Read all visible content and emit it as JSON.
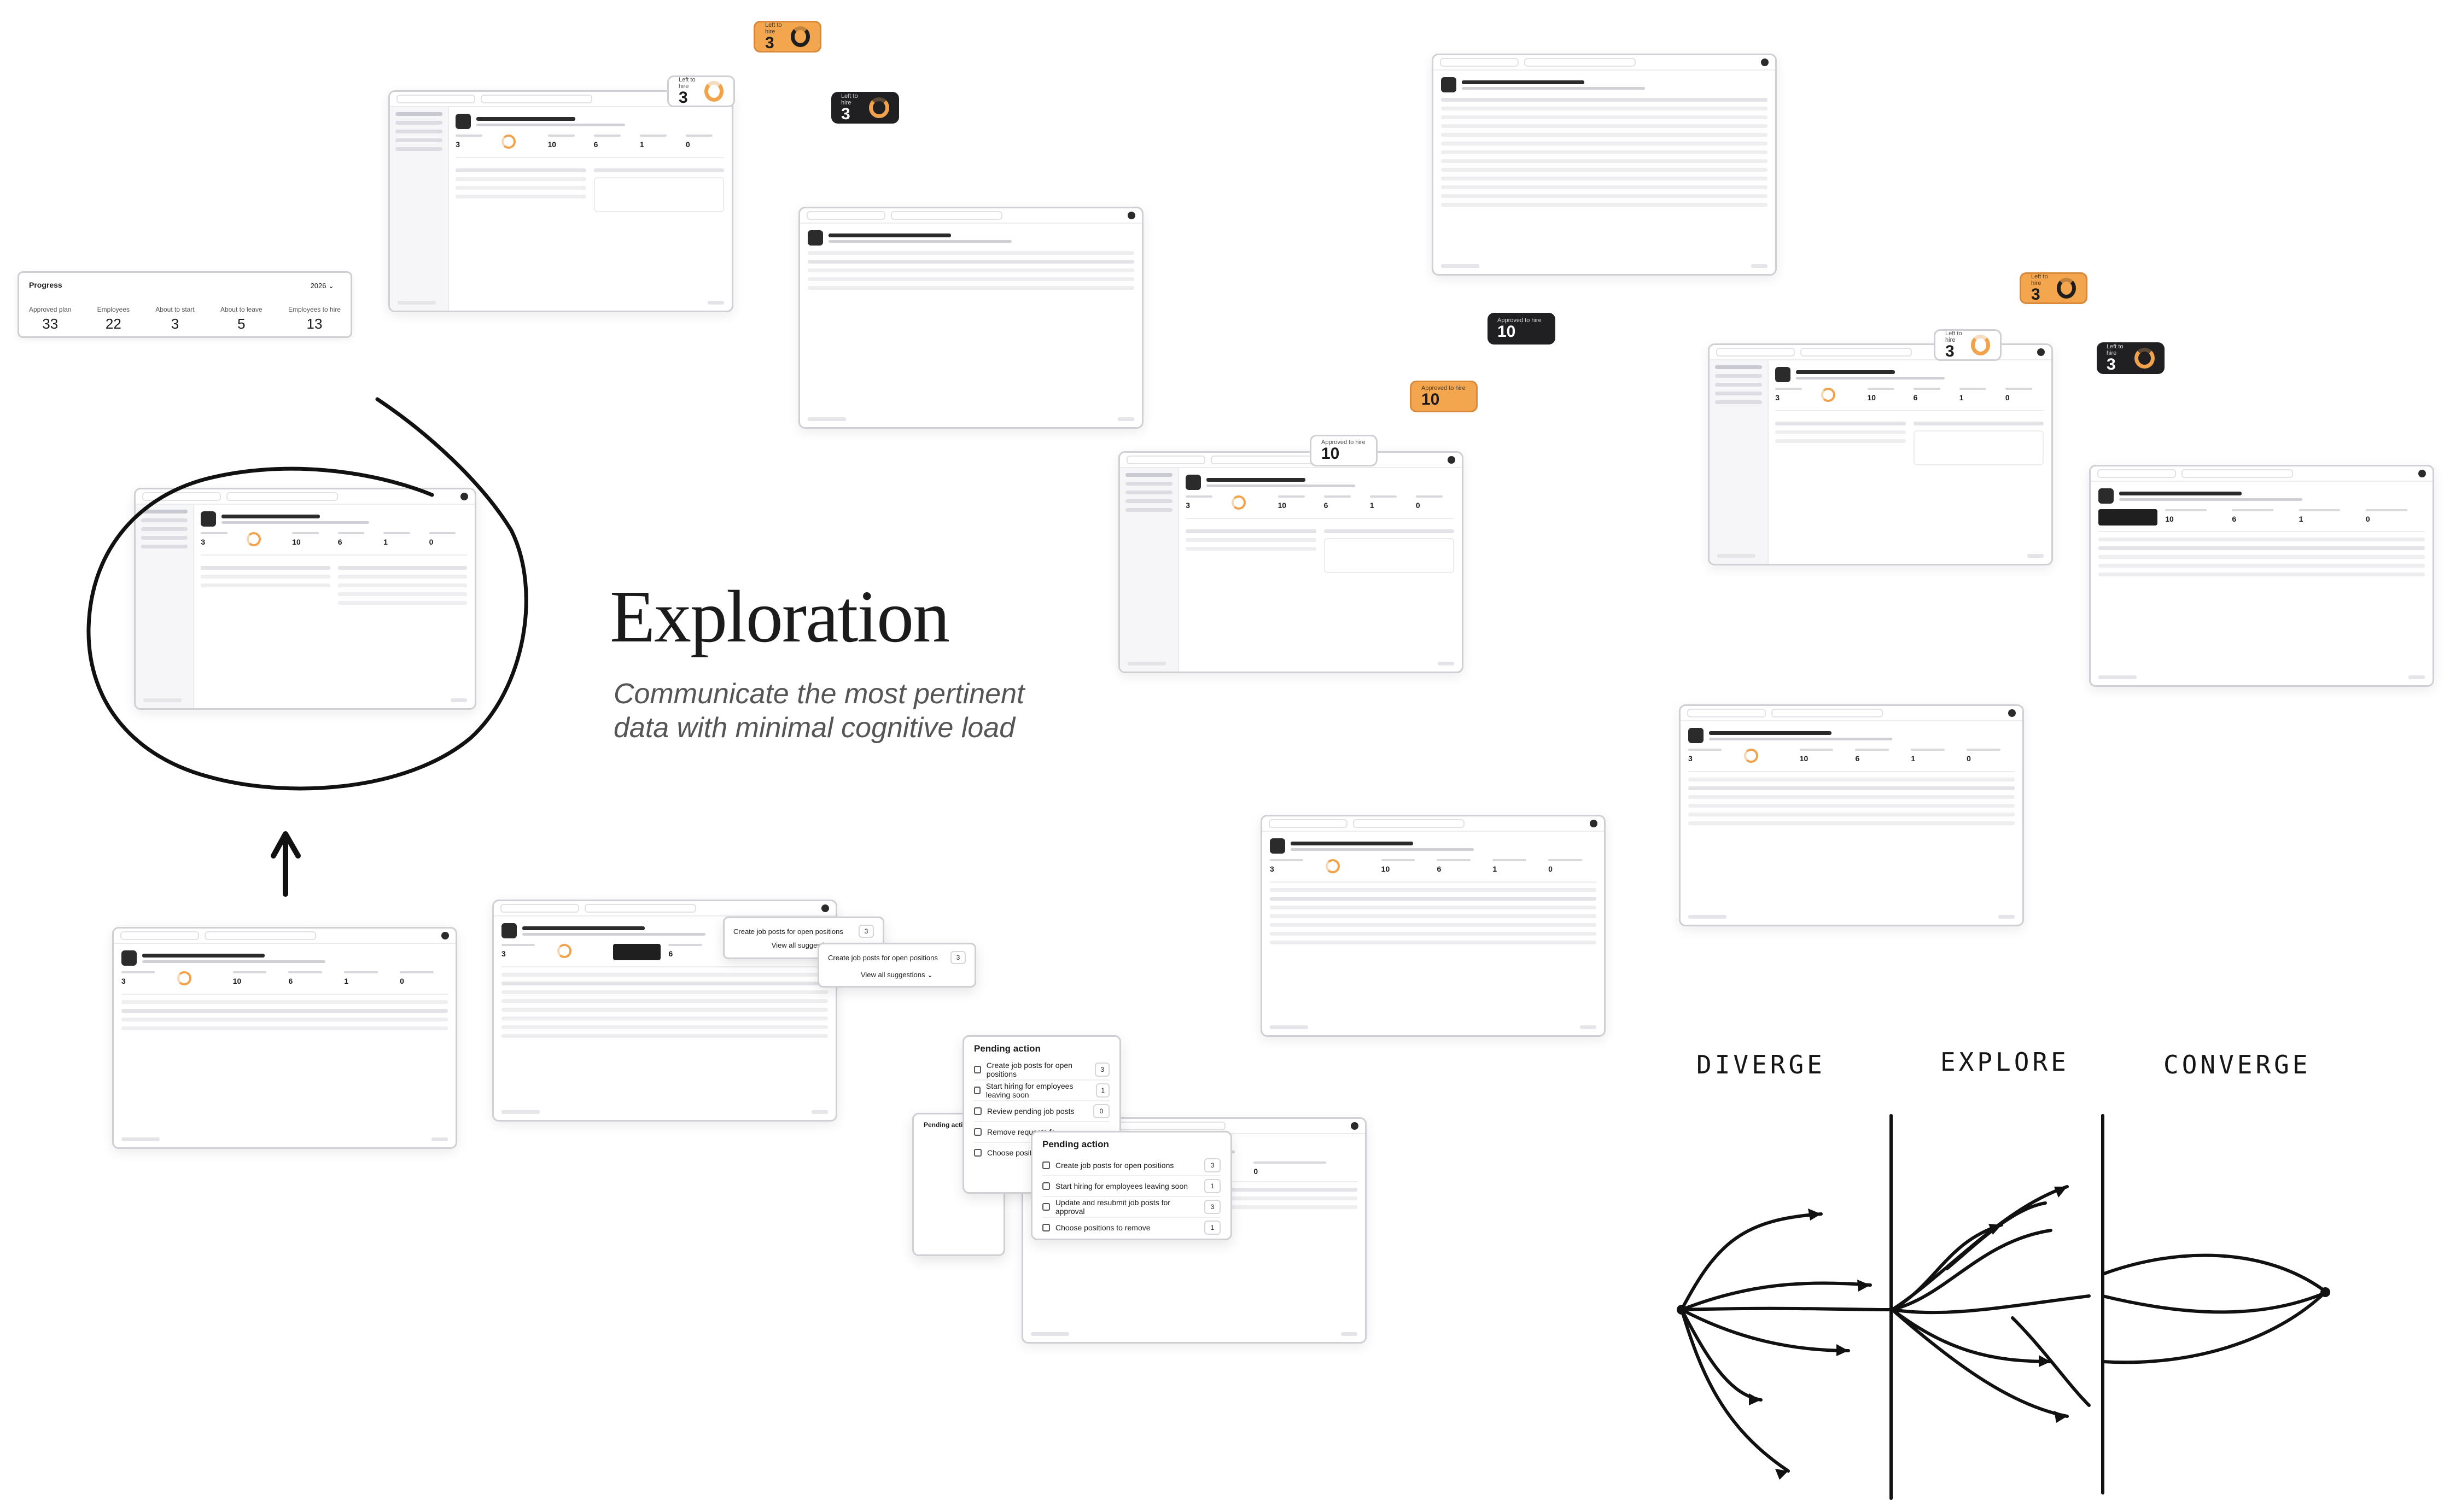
{
  "title": "Exploration",
  "subtitle_line1": "Communicate the most pertinent",
  "subtitle_line2": "data with minimal cognitive load",
  "progress": {
    "title": "Progress",
    "year": "2026 ⌄",
    "cells": [
      {
        "label": "Approved plan",
        "value": "33"
      },
      {
        "label": "Employees",
        "value": "22"
      },
      {
        "label": "About to start",
        "value": "3"
      },
      {
        "label": "About to leave",
        "value": "5"
      },
      {
        "label": "Employees to hire",
        "value": "13"
      }
    ]
  },
  "chips": {
    "orange_top": {
      "label": "Left to hire",
      "value": "3"
    },
    "dark_top": {
      "label": "Left to hire",
      "value": "3"
    },
    "light_top": {
      "label": "Left to hire",
      "value": "3"
    },
    "approved_dark": {
      "label": "Approved to hire",
      "value": "10"
    },
    "approved_orange": {
      "label": "Approved to hire",
      "value": "10"
    },
    "approved_light": {
      "label": "Approved to hire",
      "value": "10"
    },
    "orange_right": {
      "label": "Left to hire",
      "value": "3"
    },
    "dark_right": {
      "label": "Left to hire",
      "value": "3"
    },
    "light_right": {
      "label": "Left to hire",
      "value": "3"
    }
  },
  "pending_a": {
    "title": "Pending action",
    "items": [
      {
        "label": "Create job posts for open positions",
        "count": "3"
      },
      {
        "label": "Start hiring for employees leaving soon",
        "count": "1"
      },
      {
        "label": "Review pending job posts",
        "count": "0"
      },
      {
        "label": "Remove requests fo...",
        "count": ""
      },
      {
        "label": "Choose positions to...",
        "count": ""
      }
    ]
  },
  "pending_b": {
    "title": "Pending action",
    "items": [
      {
        "label": "Create job posts for open positions",
        "count": "3"
      },
      {
        "label": "Start hiring for employees leaving soon",
        "count": "1"
      },
      {
        "label": "Update and resubmit job posts for approval",
        "count": "3"
      },
      {
        "label": "Choose positions to remove",
        "count": "1"
      }
    ]
  },
  "suggest": {
    "item1": "Create job posts for open positions",
    "item1_count": "3",
    "view_all": "View all suggestions",
    "item2": "Create job posts for open positions",
    "item2_count": "3",
    "view_all2": "View all suggestions ⌄"
  },
  "sketch": {
    "diverge": "DIVERGE",
    "explore": "EXPLORE",
    "converge": "CONVERGE"
  }
}
